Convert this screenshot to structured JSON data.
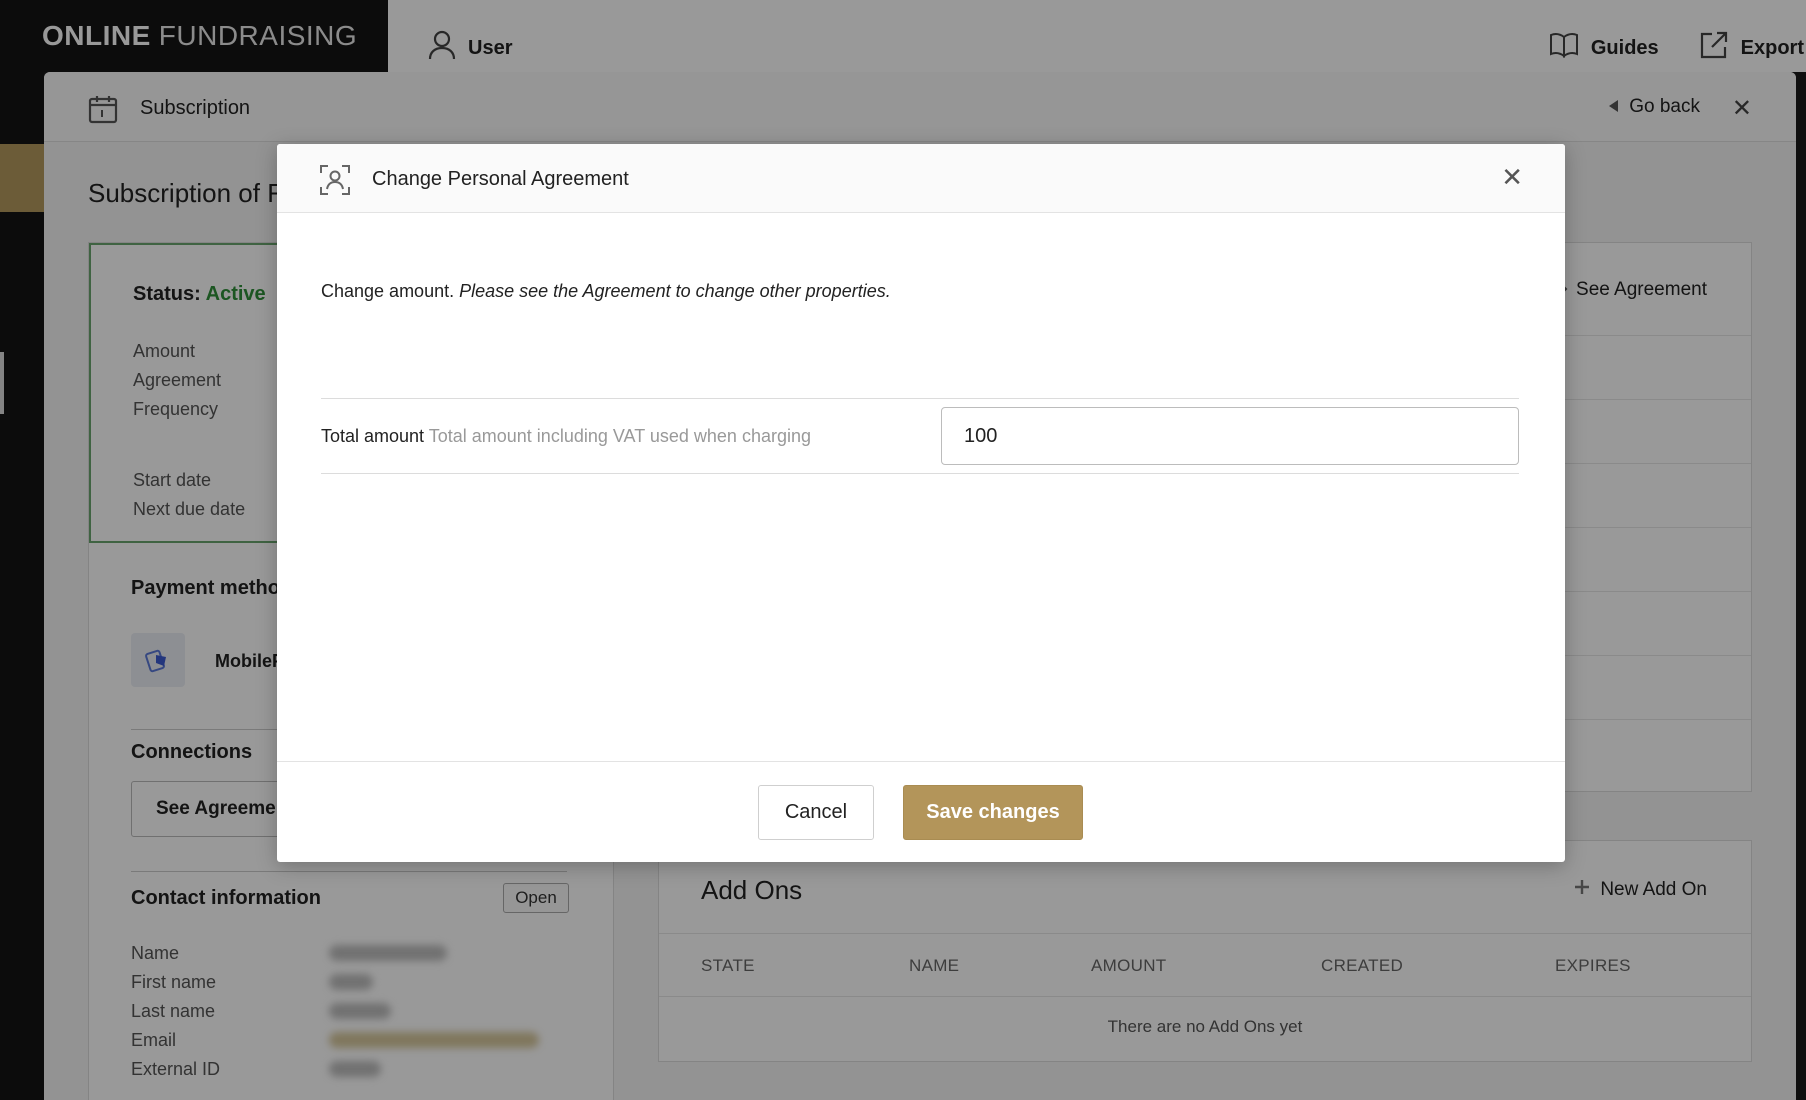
{
  "app": {
    "brand_bold": "ONLINE",
    "brand_light": "FUNDRAISING",
    "user_label": "User",
    "guides_label": "Guides",
    "export_label": "Export"
  },
  "panel": {
    "title": "Subscription",
    "go_back": "Go back",
    "page_title": "Subscription of F",
    "status_label": "Status:",
    "status_value": "Active",
    "fields": [
      "Amount",
      "Agreement",
      "Frequency",
      "Start date",
      "Next due date"
    ],
    "payment_method_title": "Payment metho",
    "payment_method_name": "MobileP",
    "connections_title": "Connections",
    "see_agreement_button": "See Agreemen",
    "contact_title": "Contact information",
    "open_button": "Open",
    "contact_fields": [
      "Name",
      "First name",
      "Last name",
      "Email",
      "External ID"
    ],
    "see_agreement_link": "See Agreement"
  },
  "addons": {
    "title": "Add Ons",
    "new_label": "New Add On",
    "columns": [
      "STATE",
      "NAME",
      "AMOUNT",
      "CREATED",
      "EXPIRES"
    ],
    "empty_text": "There are no Add Ons yet"
  },
  "modal": {
    "title": "Change Personal Agreement",
    "intro_plain": "Change amount.",
    "intro_italic": "Please see the Agreement to change other properties.",
    "field_label": "Total amount",
    "field_hint": "Total amount including VAT used when charging",
    "amount_value": "100",
    "cancel_label": "Cancel",
    "save_label": "Save changes"
  },
  "colors": {
    "accent": "#b3955a",
    "status_active": "#2f8f3a",
    "status_border": "#6aa66e"
  }
}
